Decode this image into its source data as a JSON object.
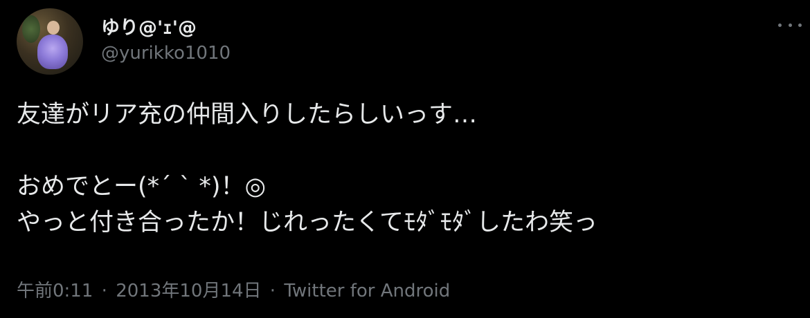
{
  "user": {
    "display_name": "ゆり@'ｪ'@",
    "handle": "@yurikko1010"
  },
  "tweet": {
    "lines": [
      "友達がリア充の仲間入りしたらしいっす…",
      "",
      "おめでとー(*´ ` *)！◎",
      "やっと付き合ったか！じれったくてﾓﾀﾞﾓﾀﾞしたわ笑っ"
    ]
  },
  "meta": {
    "time": "午前0:11",
    "date": "2013年10月14日",
    "source": "Twitter for Android",
    "separator": "·"
  },
  "icons": {
    "more": "more-horizontal-icon"
  },
  "colors": {
    "background": "#000000",
    "primary_text": "#e7e9ea",
    "secondary_text": "#71767b"
  }
}
